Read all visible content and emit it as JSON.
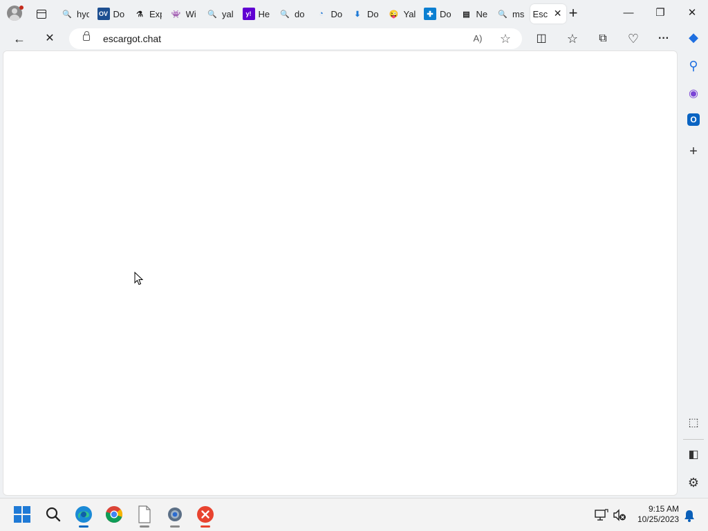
{
  "tabs": [
    {
      "title": "hyd",
      "icon": "search-icon",
      "fav": "🔍"
    },
    {
      "title": "Do",
      "icon": "ov-icon",
      "fav": "OV"
    },
    {
      "title": "Exp",
      "icon": "flask-icon",
      "fav": "⚗"
    },
    {
      "title": "Wi",
      "icon": "monster-icon",
      "fav": "👾"
    },
    {
      "title": "yal",
      "icon": "search-icon",
      "fav": "🔍"
    },
    {
      "title": "He",
      "icon": "yahoo-icon",
      "fav": "y!"
    },
    {
      "title": "do",
      "icon": "search-icon",
      "fav": "🔍"
    },
    {
      "title": "Do",
      "icon": "swirl-icon",
      "fav": "◔"
    },
    {
      "title": "Do",
      "icon": "download-icon",
      "fav": "⬇"
    },
    {
      "title": "Yal",
      "icon": "emoji-icon",
      "fav": "😜"
    },
    {
      "title": "Do",
      "icon": "plus-badge-icon",
      "fav": "✚"
    },
    {
      "title": "Ne",
      "icon": "news-icon",
      "fav": "▤"
    },
    {
      "title": "ms",
      "icon": "search-icon",
      "fav": "🔍"
    }
  ],
  "active_tab": {
    "title": "Esc",
    "close": "✕"
  },
  "new_tab": "+",
  "window_controls": {
    "minimize": "—",
    "restore": "❐",
    "close": "✕"
  },
  "nav": {
    "back": "←",
    "stop": "✕"
  },
  "address": {
    "url": "escargot.chat"
  },
  "omni_icons": {
    "read_aloud": "A)",
    "favorite": "☆"
  },
  "toolbar": {
    "split": "◫",
    "favorites": "☆",
    "collections": "⧉",
    "health": "♡",
    "more": "···"
  },
  "sidebar": {
    "copilot": "◆",
    "search": "⚲",
    "office": "◉",
    "outlook": "O",
    "add": "+",
    "screenshot": "⬚",
    "panel": "◧",
    "settings": "⚙"
  },
  "taskbar": {
    "time": "9:15 AM",
    "date": "10/25/2023"
  },
  "colors": {
    "accent": "#0067c0",
    "tab_bg": "#eff1f3",
    "content_bg": "#ffffff"
  }
}
